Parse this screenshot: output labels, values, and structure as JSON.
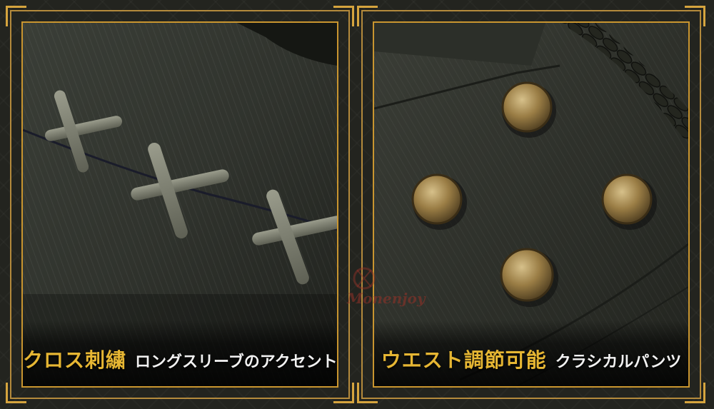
{
  "panels": [
    {
      "caption_main": "クロス刺繍",
      "caption_sub": "ロングスリーブのアクセント"
    },
    {
      "caption_main": "ウエスト調節可能",
      "caption_sub": "クラシカルパンツ"
    }
  ],
  "watermark": {
    "text": "Monenjoy"
  },
  "colors": {
    "gold": "#e6b633",
    "frame": "#c9952f",
    "fabric": "#2f332c"
  }
}
